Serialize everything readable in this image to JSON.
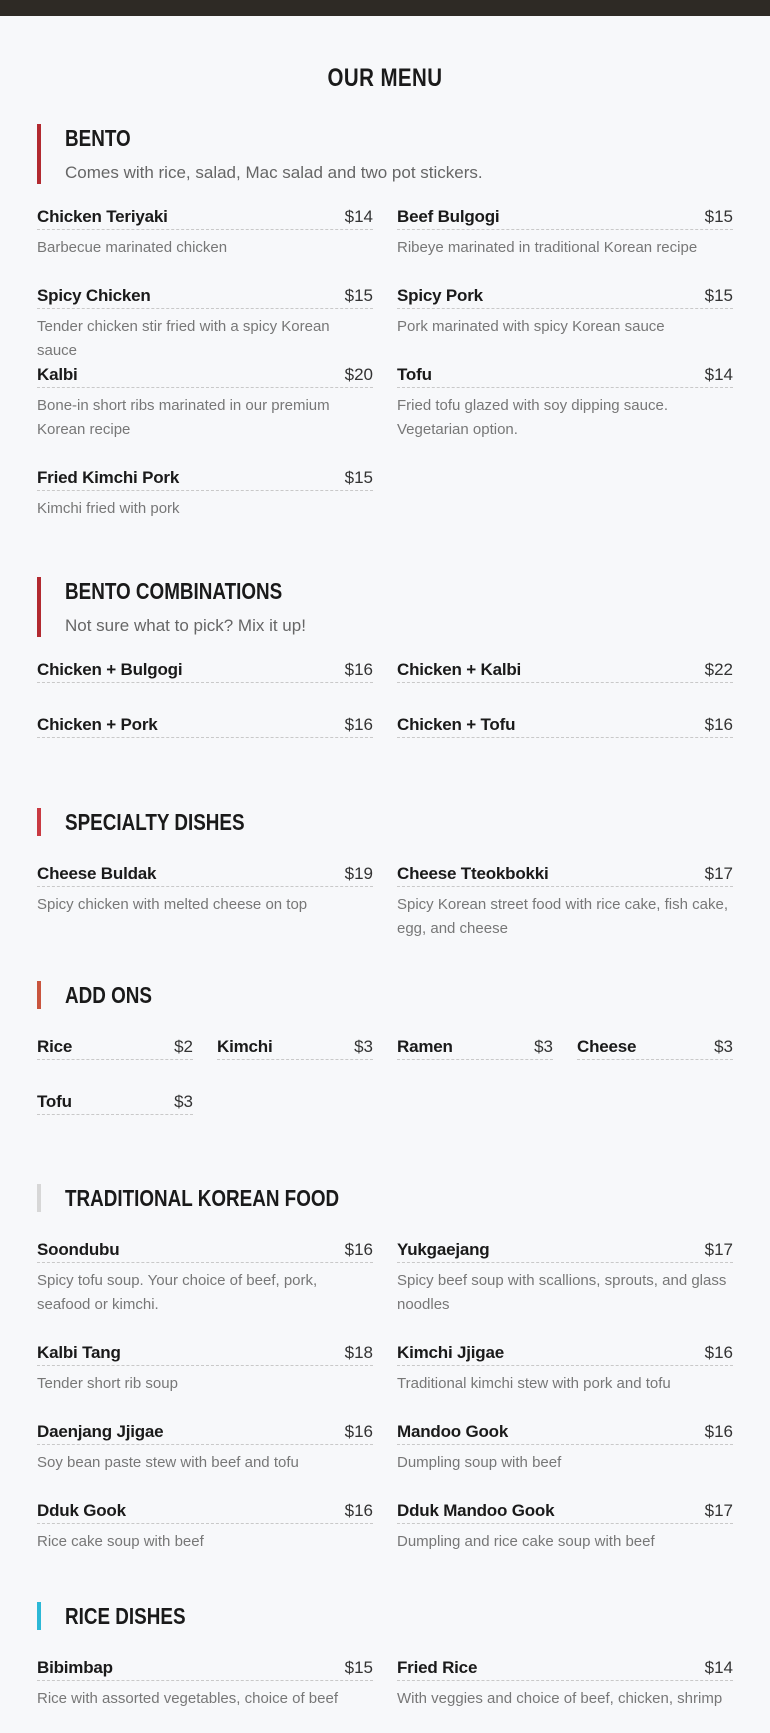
{
  "page": {
    "title": "OUR MENU"
  },
  "sections": {
    "bento": {
      "title": "BENTO",
      "desc": "Comes with rice, salad, Mac salad and two pot stickers.",
      "accent": "#b22a30",
      "items": [
        {
          "name": "Chicken Teriyaki",
          "price": "$14",
          "desc": "Barbecue marinated chicken"
        },
        {
          "name": "Beef Bulgogi",
          "price": "$15",
          "desc": "Ribeye marinated in traditional Korean recipe"
        },
        {
          "name": "Spicy Chicken",
          "price": "$15",
          "desc": "Tender chicken stir fried with a spicy Korean sauce"
        },
        {
          "name": "Spicy Pork",
          "price": "$15",
          "desc": "Pork marinated with spicy Korean sauce"
        },
        {
          "name": "Kalbi",
          "price": "$20",
          "desc": "Bone-in short ribs marinated in our premium Korean recipe"
        },
        {
          "name": "Tofu",
          "price": "$14",
          "desc": "Fried tofu glazed with soy dipping sauce. Vegetarian option."
        },
        {
          "name": "Fried Kimchi Pork",
          "price": "$15",
          "desc": "Kimchi fried with pork"
        }
      ]
    },
    "combos": {
      "title": "BENTO COMBINATIONS",
      "desc": "Not sure what to pick? Mix it up!",
      "accent": "#b22a30",
      "items": [
        {
          "name": "Chicken + Bulgogi",
          "price": "$16"
        },
        {
          "name": "Chicken + Kalbi",
          "price": "$22"
        },
        {
          "name": "Chicken + Pork",
          "price": "$16"
        },
        {
          "name": "Chicken + Tofu",
          "price": "$16"
        }
      ]
    },
    "specialty": {
      "title": "SPECIALTY DISHES",
      "accent": "#c93a42",
      "items": [
        {
          "name": "Cheese Buldak",
          "price": "$19",
          "desc": "Spicy chicken with melted cheese on top"
        },
        {
          "name": "Cheese Tteokbokki",
          "price": "$17",
          "desc": "Spicy Korean street food with rice cake, fish cake, egg, and cheese"
        }
      ]
    },
    "addons": {
      "title": "ADD ONS",
      "accent": "#c9553e",
      "items": [
        {
          "name": "Rice",
          "price": "$2"
        },
        {
          "name": "Kimchi",
          "price": "$3"
        },
        {
          "name": "Ramen",
          "price": "$3"
        },
        {
          "name": "Cheese",
          "price": "$3"
        },
        {
          "name": "Tofu",
          "price": "$3"
        }
      ]
    },
    "traditional": {
      "title": "TRADITIONAL KOREAN FOOD",
      "accent": "#d7d7d7",
      "items": [
        {
          "name": "Soondubu",
          "price": "$16",
          "desc": "Spicy tofu soup. Your choice of beef, pork, seafood or kimchi."
        },
        {
          "name": "Yukgaejang",
          "price": "$17",
          "desc": "Spicy beef soup with scallions, sprouts, and glass noodles"
        },
        {
          "name": "Kalbi Tang",
          "price": "$18",
          "desc": "Tender short rib soup"
        },
        {
          "name": "Kimchi Jjigae",
          "price": "$16",
          "desc": "Traditional kimchi stew with pork and tofu"
        },
        {
          "name": "Daenjang Jjigae",
          "price": "$16",
          "desc": "Soy bean paste stew with beef and tofu"
        },
        {
          "name": "Mandoo Gook",
          "price": "$16",
          "desc": "Dumpling soup with beef"
        },
        {
          "name": "Dduk Gook",
          "price": "$16",
          "desc": "Rice cake soup with beef"
        },
        {
          "name": "Dduk Mandoo Gook",
          "price": "$17",
          "desc": "Dumpling and rice cake soup with beef"
        }
      ]
    },
    "rice": {
      "title": "RICE DISHES",
      "accent": "#2cb8d6",
      "items": [
        {
          "name": "Bibimbap",
          "price": "$15",
          "desc": "Rice with assorted vegetables, choice of beef"
        },
        {
          "name": "Fried Rice",
          "price": "$14",
          "desc": "With veggies and choice of beef, chicken, shrimp"
        }
      ]
    }
  }
}
